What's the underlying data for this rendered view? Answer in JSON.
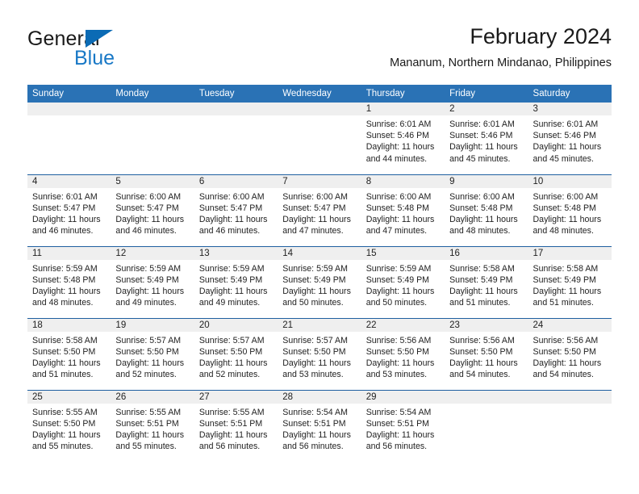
{
  "brand": {
    "word1": "General",
    "word2": "Blue",
    "sail_icon": "sail-triangle-icon",
    "accent_color": "#1878c6"
  },
  "header": {
    "title": "February 2024",
    "subtitle": "Mananum, Northern Mindanao, Philippines"
  },
  "theme": {
    "header_blue": "#2a72b5",
    "row_divider_blue": "#1f5fa0",
    "daynum_band_gray": "#efefef",
    "text_color": "#222222"
  },
  "weekdays": [
    "Sunday",
    "Monday",
    "Tuesday",
    "Wednesday",
    "Thursday",
    "Friday",
    "Saturday"
  ],
  "labels": {
    "sunrise_prefix": "Sunrise:",
    "sunset_prefix": "Sunset:",
    "daylight_prefix": "Daylight:"
  },
  "weeks": [
    {
      "days": [
        {
          "empty": true
        },
        {
          "empty": true
        },
        {
          "empty": true
        },
        {
          "empty": true
        },
        {
          "num": "1",
          "sunrise": "Sunrise: 6:01 AM",
          "sunset": "Sunset: 5:46 PM",
          "daylight1": "Daylight: 11 hours",
          "daylight2": "and 44 minutes."
        },
        {
          "num": "2",
          "sunrise": "Sunrise: 6:01 AM",
          "sunset": "Sunset: 5:46 PM",
          "daylight1": "Daylight: 11 hours",
          "daylight2": "and 45 minutes."
        },
        {
          "num": "3",
          "sunrise": "Sunrise: 6:01 AM",
          "sunset": "Sunset: 5:46 PM",
          "daylight1": "Daylight: 11 hours",
          "daylight2": "and 45 minutes."
        }
      ]
    },
    {
      "days": [
        {
          "num": "4",
          "sunrise": "Sunrise: 6:01 AM",
          "sunset": "Sunset: 5:47 PM",
          "daylight1": "Daylight: 11 hours",
          "daylight2": "and 46 minutes."
        },
        {
          "num": "5",
          "sunrise": "Sunrise: 6:00 AM",
          "sunset": "Sunset: 5:47 PM",
          "daylight1": "Daylight: 11 hours",
          "daylight2": "and 46 minutes."
        },
        {
          "num": "6",
          "sunrise": "Sunrise: 6:00 AM",
          "sunset": "Sunset: 5:47 PM",
          "daylight1": "Daylight: 11 hours",
          "daylight2": "and 46 minutes."
        },
        {
          "num": "7",
          "sunrise": "Sunrise: 6:00 AM",
          "sunset": "Sunset: 5:47 PM",
          "daylight1": "Daylight: 11 hours",
          "daylight2": "and 47 minutes."
        },
        {
          "num": "8",
          "sunrise": "Sunrise: 6:00 AM",
          "sunset": "Sunset: 5:48 PM",
          "daylight1": "Daylight: 11 hours",
          "daylight2": "and 47 minutes."
        },
        {
          "num": "9",
          "sunrise": "Sunrise: 6:00 AM",
          "sunset": "Sunset: 5:48 PM",
          "daylight1": "Daylight: 11 hours",
          "daylight2": "and 48 minutes."
        },
        {
          "num": "10",
          "sunrise": "Sunrise: 6:00 AM",
          "sunset": "Sunset: 5:48 PM",
          "daylight1": "Daylight: 11 hours",
          "daylight2": "and 48 minutes."
        }
      ]
    },
    {
      "days": [
        {
          "num": "11",
          "sunrise": "Sunrise: 5:59 AM",
          "sunset": "Sunset: 5:48 PM",
          "daylight1": "Daylight: 11 hours",
          "daylight2": "and 48 minutes."
        },
        {
          "num": "12",
          "sunrise": "Sunrise: 5:59 AM",
          "sunset": "Sunset: 5:49 PM",
          "daylight1": "Daylight: 11 hours",
          "daylight2": "and 49 minutes."
        },
        {
          "num": "13",
          "sunrise": "Sunrise: 5:59 AM",
          "sunset": "Sunset: 5:49 PM",
          "daylight1": "Daylight: 11 hours",
          "daylight2": "and 49 minutes."
        },
        {
          "num": "14",
          "sunrise": "Sunrise: 5:59 AM",
          "sunset": "Sunset: 5:49 PM",
          "daylight1": "Daylight: 11 hours",
          "daylight2": "and 50 minutes."
        },
        {
          "num": "15",
          "sunrise": "Sunrise: 5:59 AM",
          "sunset": "Sunset: 5:49 PM",
          "daylight1": "Daylight: 11 hours",
          "daylight2": "and 50 minutes."
        },
        {
          "num": "16",
          "sunrise": "Sunrise: 5:58 AM",
          "sunset": "Sunset: 5:49 PM",
          "daylight1": "Daylight: 11 hours",
          "daylight2": "and 51 minutes."
        },
        {
          "num": "17",
          "sunrise": "Sunrise: 5:58 AM",
          "sunset": "Sunset: 5:49 PM",
          "daylight1": "Daylight: 11 hours",
          "daylight2": "and 51 minutes."
        }
      ]
    },
    {
      "days": [
        {
          "num": "18",
          "sunrise": "Sunrise: 5:58 AM",
          "sunset": "Sunset: 5:50 PM",
          "daylight1": "Daylight: 11 hours",
          "daylight2": "and 51 minutes."
        },
        {
          "num": "19",
          "sunrise": "Sunrise: 5:57 AM",
          "sunset": "Sunset: 5:50 PM",
          "daylight1": "Daylight: 11 hours",
          "daylight2": "and 52 minutes."
        },
        {
          "num": "20",
          "sunrise": "Sunrise: 5:57 AM",
          "sunset": "Sunset: 5:50 PM",
          "daylight1": "Daylight: 11 hours",
          "daylight2": "and 52 minutes."
        },
        {
          "num": "21",
          "sunrise": "Sunrise: 5:57 AM",
          "sunset": "Sunset: 5:50 PM",
          "daylight1": "Daylight: 11 hours",
          "daylight2": "and 53 minutes."
        },
        {
          "num": "22",
          "sunrise": "Sunrise: 5:56 AM",
          "sunset": "Sunset: 5:50 PM",
          "daylight1": "Daylight: 11 hours",
          "daylight2": "and 53 minutes."
        },
        {
          "num": "23",
          "sunrise": "Sunrise: 5:56 AM",
          "sunset": "Sunset: 5:50 PM",
          "daylight1": "Daylight: 11 hours",
          "daylight2": "and 54 minutes."
        },
        {
          "num": "24",
          "sunrise": "Sunrise: 5:56 AM",
          "sunset": "Sunset: 5:50 PM",
          "daylight1": "Daylight: 11 hours",
          "daylight2": "and 54 minutes."
        }
      ]
    },
    {
      "days": [
        {
          "num": "25",
          "sunrise": "Sunrise: 5:55 AM",
          "sunset": "Sunset: 5:50 PM",
          "daylight1": "Daylight: 11 hours",
          "daylight2": "and 55 minutes."
        },
        {
          "num": "26",
          "sunrise": "Sunrise: 5:55 AM",
          "sunset": "Sunset: 5:51 PM",
          "daylight1": "Daylight: 11 hours",
          "daylight2": "and 55 minutes."
        },
        {
          "num": "27",
          "sunrise": "Sunrise: 5:55 AM",
          "sunset": "Sunset: 5:51 PM",
          "daylight1": "Daylight: 11 hours",
          "daylight2": "and 56 minutes."
        },
        {
          "num": "28",
          "sunrise": "Sunrise: 5:54 AM",
          "sunset": "Sunset: 5:51 PM",
          "daylight1": "Daylight: 11 hours",
          "daylight2": "and 56 minutes."
        },
        {
          "num": "29",
          "sunrise": "Sunrise: 5:54 AM",
          "sunset": "Sunset: 5:51 PM",
          "daylight1": "Daylight: 11 hours",
          "daylight2": "and 56 minutes."
        },
        {
          "empty": true
        },
        {
          "empty": true
        }
      ]
    }
  ]
}
